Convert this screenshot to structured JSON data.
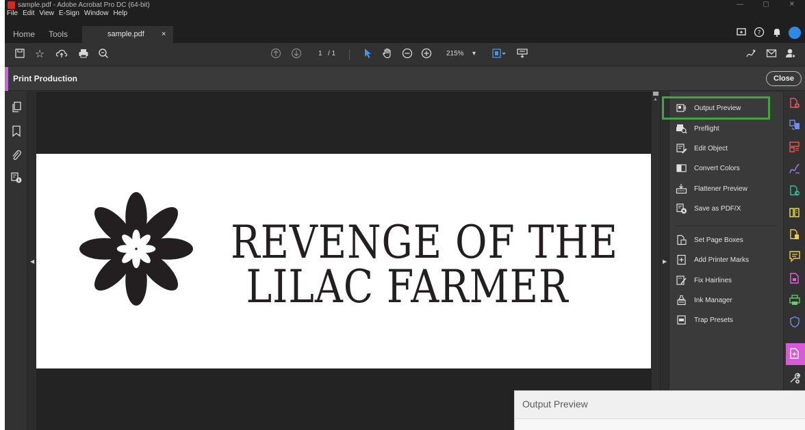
{
  "window": {
    "title": "sample.pdf - Adobe Acrobat Pro DC (64-bit)",
    "controls": [
      "—",
      "▢",
      "✕"
    ]
  },
  "menu": [
    "File",
    "Edit",
    "View",
    "E-Sign",
    "Window",
    "Help"
  ],
  "tabs": {
    "home": "Home",
    "tools": "Tools",
    "document": "sample.pdf",
    "close": "×"
  },
  "toolbar": {
    "page_current": "1",
    "page_total": "/ 1",
    "zoom": "215%",
    "zoom_caret": "▾"
  },
  "print_production": {
    "title": "Print Production",
    "close_label": "Close"
  },
  "document": {
    "headline_line1": "REVENGE OF THE",
    "headline_line2": "LILAC FARMER"
  },
  "tool_panel": {
    "items": [
      {
        "label": "Output Preview"
      },
      {
        "label": "Preflight"
      },
      {
        "label": "Edit Object"
      },
      {
        "label": "Convert Colors"
      },
      {
        "label": "Flattener Preview"
      },
      {
        "label": "Save as PDF/X"
      },
      {
        "label": "Set Page Boxes"
      },
      {
        "label": "Add Printer Marks"
      },
      {
        "label": "Fix Hairlines"
      },
      {
        "label": "Ink Manager"
      },
      {
        "label": "Trap Presets"
      }
    ]
  },
  "output_preview_window": {
    "title": "Output Preview"
  },
  "colors": {
    "accent": "#c864e6",
    "highlight": "#3fa83a",
    "avatar": "#2e8ae6",
    "cursor": "#3d95f0"
  }
}
